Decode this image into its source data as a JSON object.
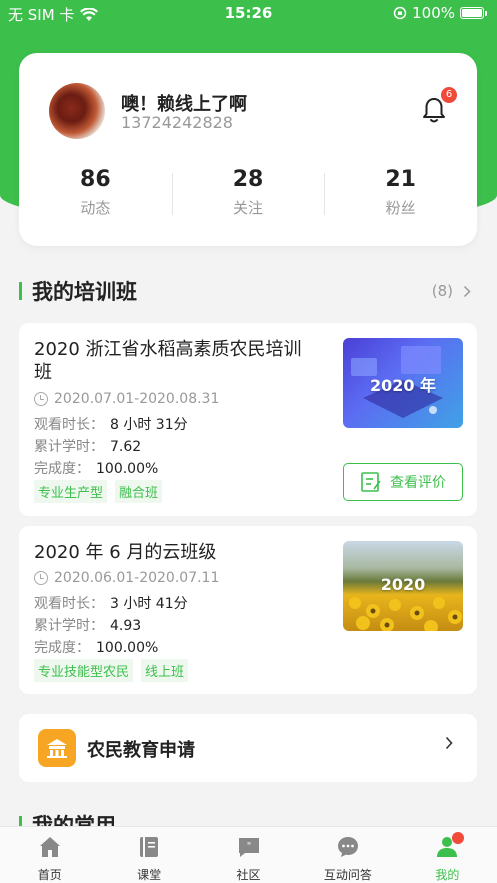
{
  "statusbar": {
    "carrier": "无 SIM 卡",
    "time": "15:26",
    "battery": "100%"
  },
  "profile": {
    "name": "噢！赖线上了啊",
    "phone": "13724242828",
    "notification_count": "6",
    "stats": [
      {
        "value": "86",
        "label": "动态"
      },
      {
        "value": "28",
        "label": "关注"
      },
      {
        "value": "21",
        "label": "粉丝"
      }
    ]
  },
  "training": {
    "title": "我的培训班",
    "count": "(8)",
    "courses": [
      {
        "title": "2020 浙江省水稻高素质农民培训班",
        "date": "2020.07.01-2020.08.31",
        "watch_label": "观看时长：",
        "watch_value": "8 小时 31分",
        "credit_label": "累计学时：",
        "credit_value": "7.62",
        "progress_label": "完成度：",
        "progress_value": "100.00%",
        "tags": [
          "专业生产型",
          "融合班"
        ],
        "thumb_text": "2020 年",
        "action": "查看评价"
      },
      {
        "title": "2020 年 6 月的云班级",
        "date": "2020.06.01-2020.07.11",
        "watch_label": "观看时长：",
        "watch_value": "3 小时 41分",
        "credit_label": "累计学时：",
        "credit_value": "4.93",
        "progress_label": "完成度：",
        "progress_value": "100.00%",
        "tags": [
          "专业技能型农民",
          "线上班"
        ],
        "thumb_text": "2020"
      }
    ]
  },
  "apply": {
    "label": "农民教育申请"
  },
  "section2": {
    "title": "我的常用"
  },
  "tabbar": [
    {
      "label": "首页",
      "icon": "home-icon"
    },
    {
      "label": "课堂",
      "icon": "book-icon"
    },
    {
      "label": "社区",
      "icon": "quote-icon"
    },
    {
      "label": "互动问答",
      "icon": "chat-icon"
    },
    {
      "label": "我的",
      "icon": "person-icon"
    }
  ],
  "colors": {
    "accent": "#3dbf4c",
    "badge": "#f04a3a",
    "apply_icon": "#f6a623"
  }
}
